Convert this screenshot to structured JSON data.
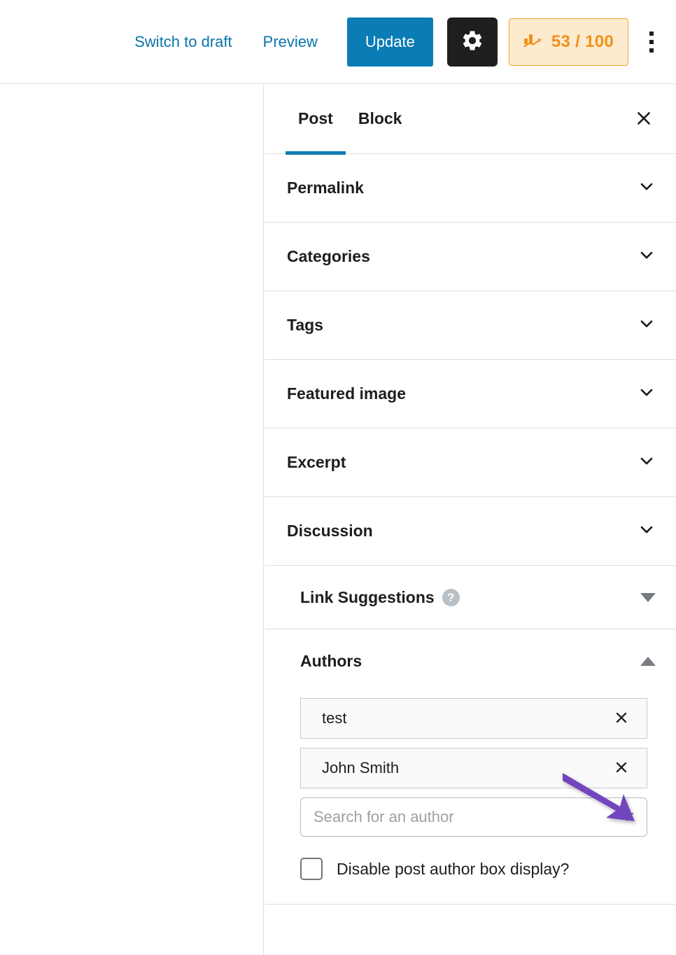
{
  "header": {
    "switch_to_draft_label": "Switch to draft",
    "preview_label": "Preview",
    "update_label": "Update",
    "settings_icon": "gear-icon",
    "seo_badge": {
      "icon": "seo-bar-chart-icon",
      "score_text": "53 / 100",
      "score": 53,
      "max": 100,
      "color": "#f39019",
      "background": "#fdebd0",
      "border": "#f0a830"
    },
    "more_menu_icon": "kebab-vertical-icon",
    "accent_color": "#0b7cb5"
  },
  "sidebar": {
    "tabs": [
      {
        "label": "Post",
        "active": true
      },
      {
        "label": "Block",
        "active": false
      }
    ],
    "close_icon": "close-icon",
    "panels": [
      {
        "label": "Permalink",
        "expanded": false,
        "icon": "chevron-down-icon"
      },
      {
        "label": "Categories",
        "expanded": false,
        "icon": "chevron-down-icon"
      },
      {
        "label": "Tags",
        "expanded": false,
        "icon": "chevron-down-icon"
      },
      {
        "label": "Featured image",
        "expanded": false,
        "icon": "chevron-down-icon"
      },
      {
        "label": "Excerpt",
        "expanded": false,
        "icon": "chevron-down-icon"
      },
      {
        "label": "Discussion",
        "expanded": false,
        "icon": "chevron-down-icon"
      }
    ],
    "link_suggestions": {
      "title": "Link Suggestions",
      "help_icon": "help-circle-icon",
      "help_glyph": "?",
      "toggle_icon": "triangle-down-icon",
      "expanded": false
    },
    "authors": {
      "title": "Authors",
      "toggle_icon": "triangle-up-icon",
      "expanded": true,
      "selected": [
        {
          "name": "test",
          "remove_icon": "close-icon"
        },
        {
          "name": "John Smith",
          "remove_icon": "close-icon"
        }
      ],
      "search": {
        "value": "",
        "placeholder": "Search for an author",
        "dropdown_icon": "triangle-down-icon"
      },
      "disable_author_box": {
        "label": "Disable post author box display?",
        "checked": false
      }
    }
  },
  "annotation": {
    "arrow_color": "#7344bf",
    "points_to": "remove-author-test-button"
  }
}
